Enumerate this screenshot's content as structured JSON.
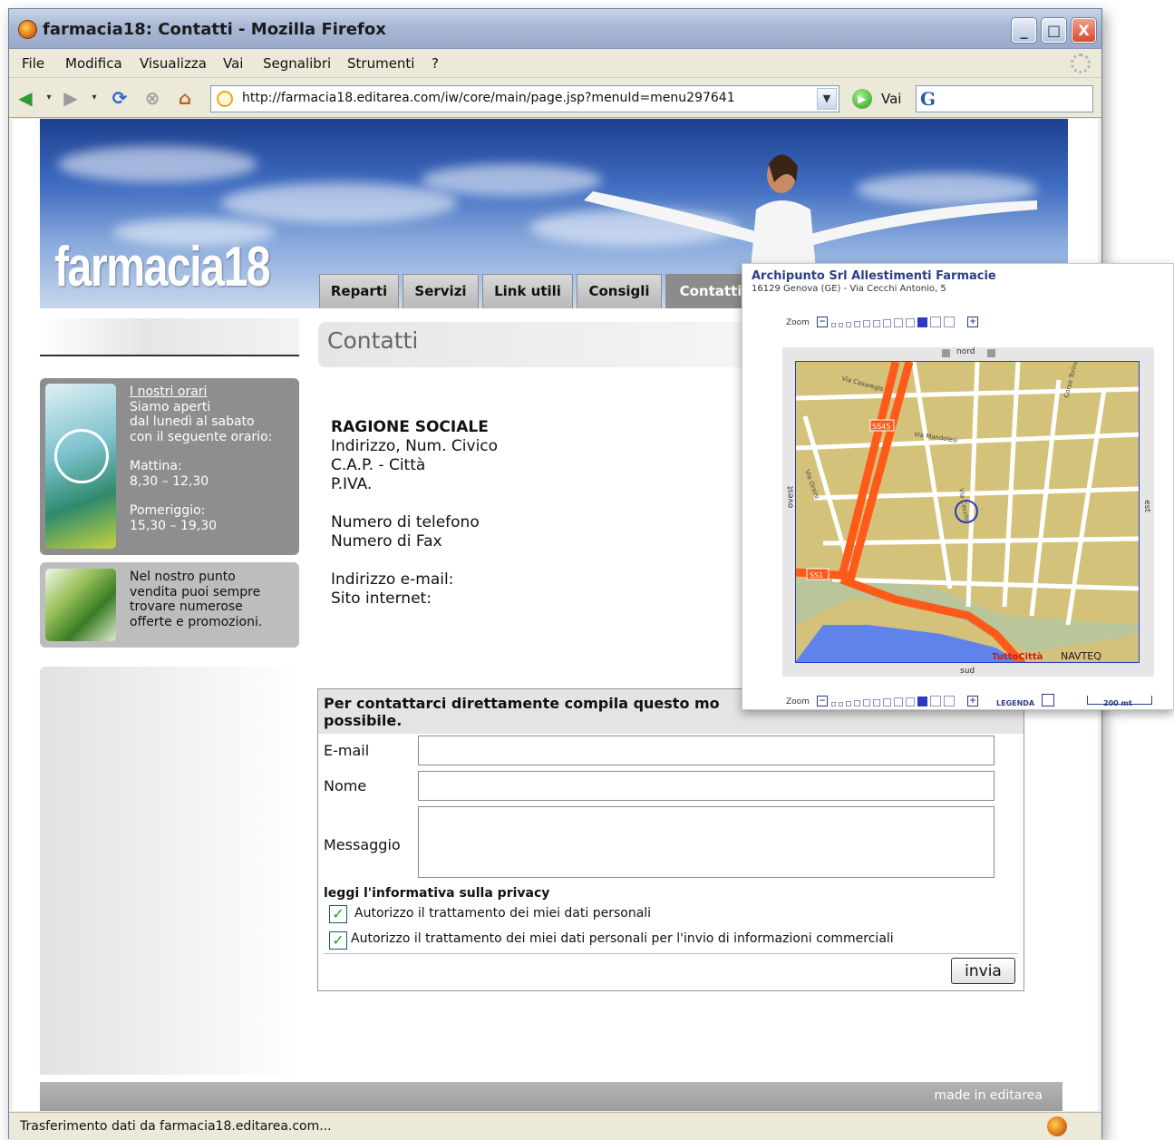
{
  "window": {
    "title": "farmacia18: Contatti - Mozilla Firefox",
    "controls": [
      "_",
      "□",
      "X"
    ]
  },
  "menubar": {
    "items": [
      "File",
      "Modifica",
      "Visualizza",
      "Vai",
      "Segnalibri",
      "Strumenti",
      "?"
    ]
  },
  "navbar": {
    "url": "http://farmacia18.editarea.com/iw/core/main/page.jsp?menuId=menu297641",
    "go_label": "Vai",
    "search_engine": "G"
  },
  "status": {
    "text": "Trasferimento dati da farmacia18.editarea.com..."
  },
  "site": {
    "logo": "farmacia18",
    "tabs": [
      "Reparti",
      "Servizi",
      "Link utili",
      "Consigli",
      "Contatti"
    ],
    "active_tab": "Contatti",
    "page_title": "Contatti",
    "sidebar": {
      "hours": {
        "link": "I nostri orari",
        "line1": "Siamo aperti",
        "line2": "dal lunedì al sabato",
        "line3": "con il seguente orario:",
        "morning_label": "Mattina:",
        "morning_hours": "8,30 – 12,30",
        "afternoon_label": "Pomeriggio:",
        "afternoon_hours": "15,30 – 19,30"
      },
      "promo": {
        "line1": "Nel nostro punto",
        "line2": "vendita puoi sempre",
        "line3": "trovare numerose",
        "line4": "offerte e promozioni."
      }
    },
    "company": {
      "name": "RAGIONE SOCIALE",
      "address": "Indirizzo, Num. Civico",
      "cap_city": "C.A.P. - Città",
      "piva": "P.IVA.",
      "phone": "Numero di telefono",
      "fax": "Numero di Fax",
      "email": "Indirizzo e-mail:",
      "website": "Sito internet:"
    },
    "form": {
      "heading_line1": "Per contattarci direttamente compila questo mo",
      "heading_line2": "possibile.",
      "email_label": "E-mail",
      "email_value": "",
      "name_label": "Nome",
      "name_value": "",
      "message_label": "Messaggio",
      "message_value": "",
      "privacy_link": "leggi l'informativa sulla privacy",
      "consent1": "Autorizzo il trattamento dei miei dati personali",
      "consent1_checked": true,
      "consent2": "Autorizzo il trattamento dei miei dati personali per l'invio di informazioni commerciali",
      "consent2_checked": true,
      "submit_label": "invia"
    },
    "footer": "made in editarea"
  },
  "map": {
    "title": "Archipunto Srl Allestimenti Farmacie",
    "address": "16129 Genova (GE) - Via Cecchi Antonio, 5",
    "zoom_label": "Zoom",
    "zoom_level": 10,
    "zoom_steps": 12,
    "north": "nord",
    "south": "sud",
    "west": "ovest",
    "east": "est",
    "road_labels": [
      "SS45",
      "SS1"
    ],
    "street_labels": [
      "Via Casaregis",
      "Via Cecchi",
      "Via Mandolesi",
      "Via Orsini",
      "Corso Torino"
    ],
    "brand": "TuttoCittà",
    "provider": "NAVTEQ",
    "legend": "LEGENDA",
    "scale": "200 mt",
    "colors": {
      "land": "#d4c27b",
      "road": "#ffffff",
      "highway": "#ff5a1a",
      "sea": "#5f83ea",
      "park": "#b9c59a",
      "frame": "#2b3bc0"
    }
  }
}
